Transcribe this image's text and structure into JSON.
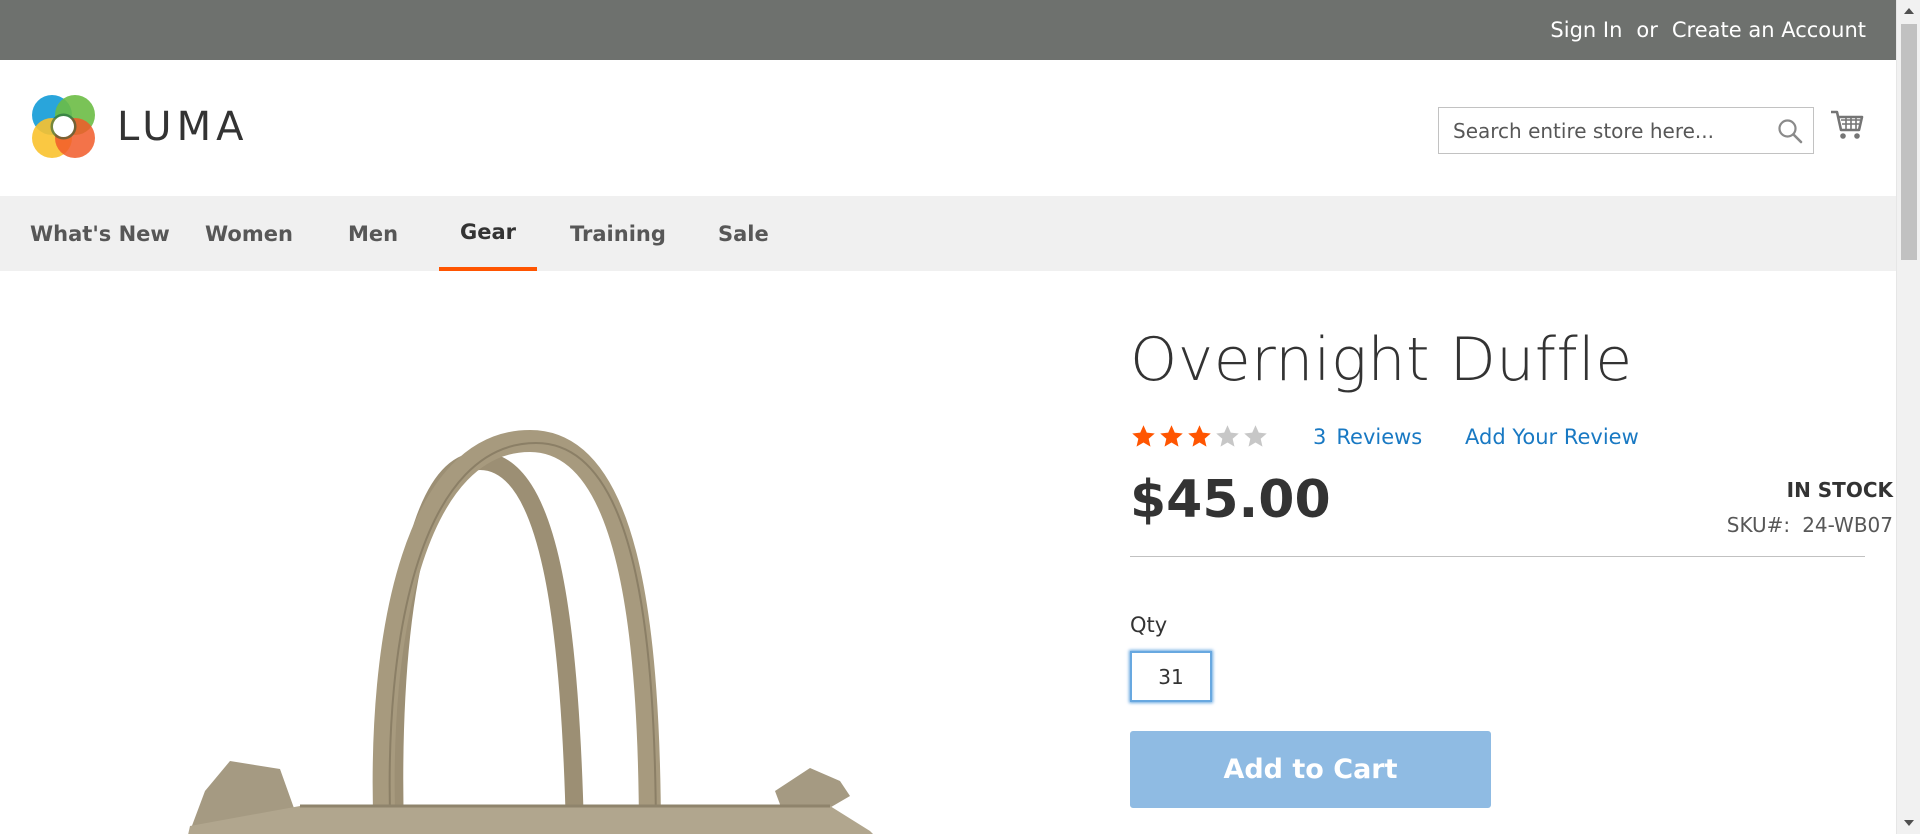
{
  "topbar": {
    "sign_in": "Sign In",
    "or": "or",
    "create_account": "Create an Account",
    "bg_color": "#6e716e"
  },
  "header": {
    "logo_text": "LUMA",
    "search_placeholder": "Search entire store here...",
    "icons": [
      "search-icon",
      "cart-icon"
    ]
  },
  "nav": {
    "items": [
      {
        "label": "What's New"
      },
      {
        "label": "Women"
      },
      {
        "label": "Men"
      },
      {
        "label": "Gear"
      },
      {
        "label": "Training"
      },
      {
        "label": "Sale"
      }
    ],
    "active": "Gear",
    "accent_color": "#ff5501"
  },
  "product": {
    "title": "Overnight Duffle",
    "rating_stars": 3,
    "rating_max": 5,
    "reviews_count": "3",
    "reviews_label": "Reviews",
    "add_review": "Add Your Review",
    "price": "$45.00",
    "stock": "IN STOCK",
    "sku_label": "SKU#:",
    "sku_value": "24-WB07",
    "qty_label": "Qty",
    "qty_value": "31",
    "add_to_cart": "Add to Cart",
    "link_color": "#1979c3",
    "button_color": "#8fbbe3"
  }
}
